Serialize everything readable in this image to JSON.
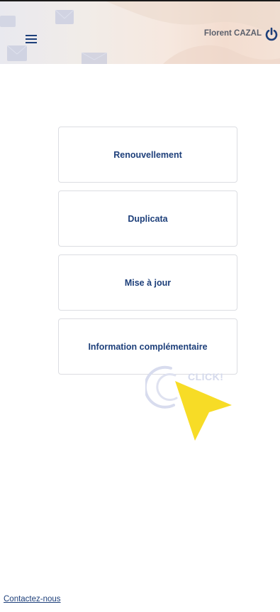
{
  "header": {
    "user_name": "Florent CAZAL",
    "menu_icon": "hamburger-menu-icon",
    "logout_icon": "power-icon"
  },
  "menu": {
    "items": [
      {
        "label": "Renouvellement"
      },
      {
        "label": "Duplicata"
      },
      {
        "label": "Mise à jour"
      },
      {
        "label": "Information complémentaire"
      }
    ]
  },
  "overlay": {
    "click_text": "CLICK!"
  },
  "footer": {
    "contact_label": "Contactez-nous"
  },
  "colors": {
    "primary": "#1d3f7a",
    "card_border": "#dcdde2",
    "cursor_yellow": "#f7dc26"
  }
}
